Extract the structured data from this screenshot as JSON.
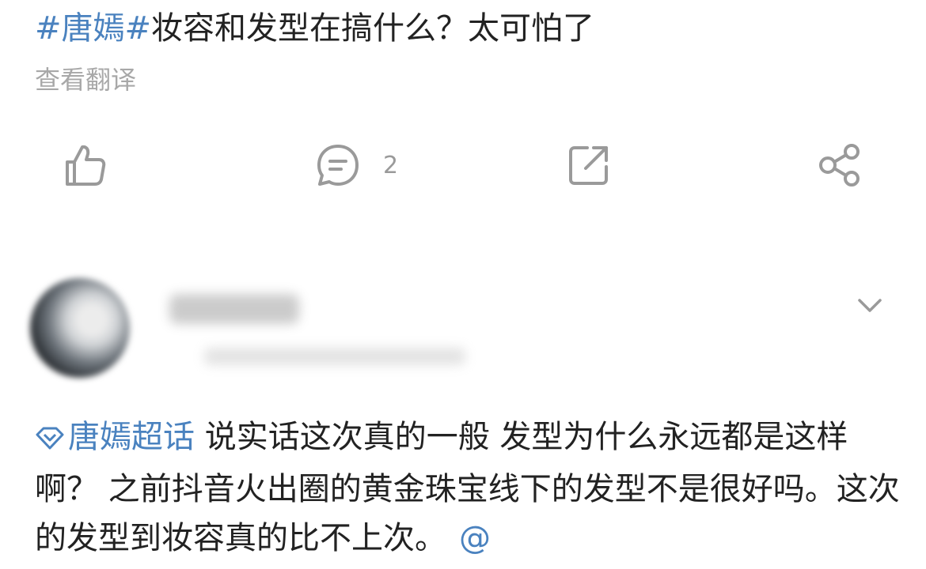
{
  "post": {
    "topic": "#唐嫣#",
    "title": "妆容和发型在搞什么？太可怕了",
    "translate_label": "查看翻译"
  },
  "actions": {
    "like_icon": "thumbs-up-icon",
    "comment_icon": "comment-bubble-icon",
    "comment_count": "2",
    "repost_icon": "repost-icon",
    "share_icon": "share-icon"
  },
  "reply": {
    "avatar_state": "blurred",
    "username_state": "blurred",
    "expand_icon": "chevron-down-icon",
    "supertopic_icon": "diamond-icon",
    "supertopic": "唐嫣超话",
    "text": "说实话这次真的一般  发型为什么永远都是这样啊？ 之前抖音火出圈的黄金珠宝线下的发型不是很好吗。这次的发型到妆容真的比不上次。",
    "mention": "@"
  },
  "colors": {
    "link": "#4a82bf",
    "text": "#222222",
    "muted": "#a8a8a8",
    "icon": "#9a9a9a"
  }
}
